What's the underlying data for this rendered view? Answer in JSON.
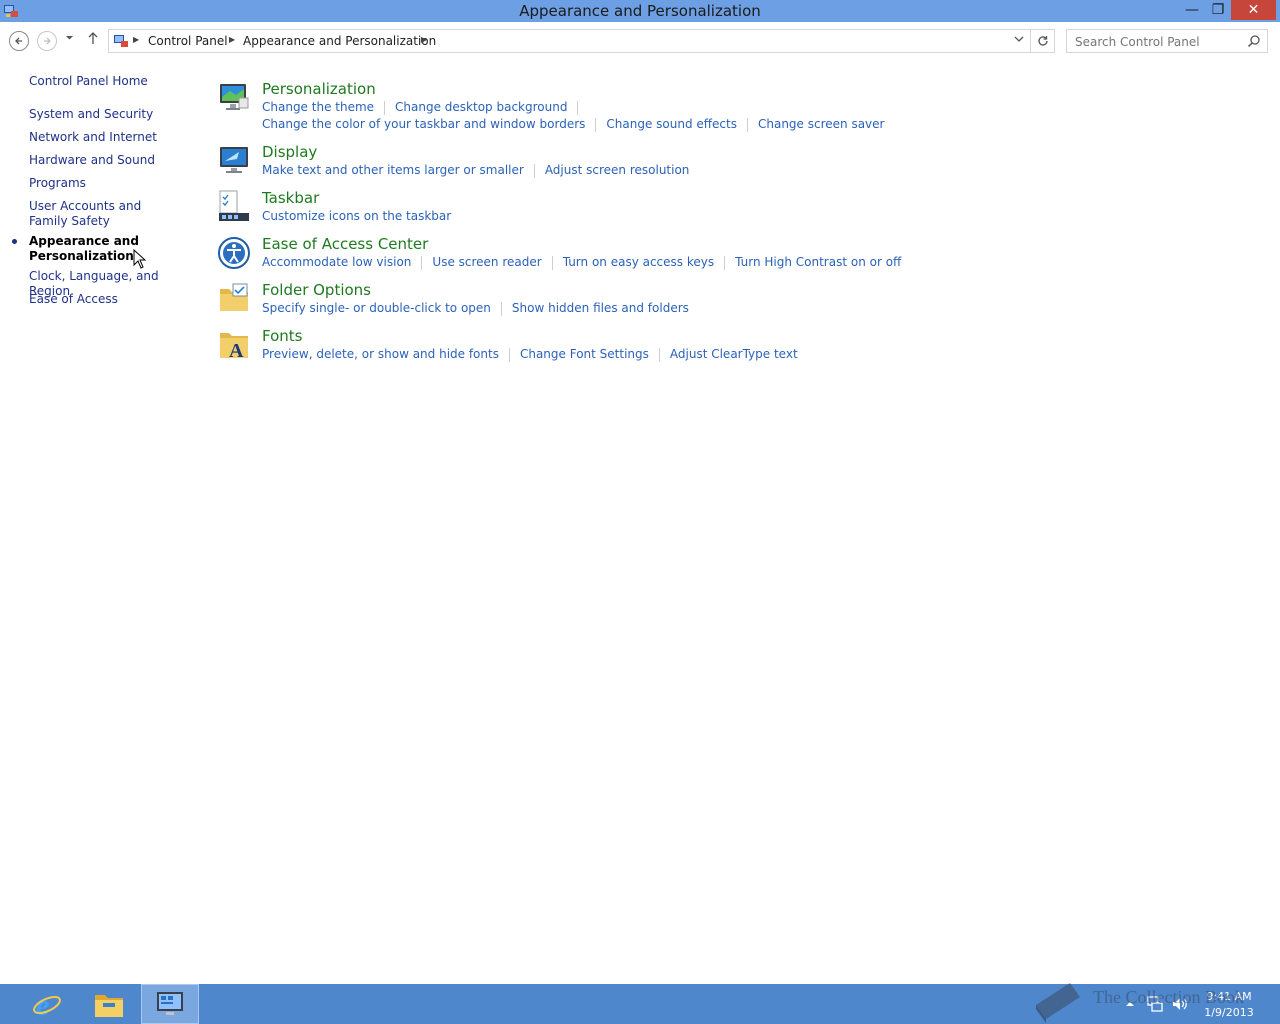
{
  "window": {
    "title": "Appearance and Personalization",
    "minimize_glyph": "—",
    "restore_glyph": "❐",
    "close_glyph": "✕"
  },
  "address_bar": {
    "breadcrumbs": [
      "Control Panel",
      "Appearance and Personalization"
    ],
    "search_placeholder": "Search Control Panel"
  },
  "sidebar": {
    "home": "Control Panel Home",
    "items": [
      {
        "label": "System and Security"
      },
      {
        "label": "Network and Internet"
      },
      {
        "label": "Hardware and Sound"
      },
      {
        "label": "Programs"
      },
      {
        "label": "User Accounts and Family Safety"
      },
      {
        "label": "Appearance and Personalization",
        "current": true
      },
      {
        "label": "Clock, Language, and Region"
      },
      {
        "label": "Ease of Access"
      }
    ]
  },
  "categories": [
    {
      "title": "Personalization",
      "icon": "personalization-icon",
      "links": [
        "Change the theme",
        "Change desktop background",
        "Change the color of your taskbar and window borders",
        "Change sound effects",
        "Change screen saver"
      ]
    },
    {
      "title": "Display",
      "icon": "display-icon",
      "links": [
        "Make text and other items larger or smaller",
        "Adjust screen resolution"
      ]
    },
    {
      "title": "Taskbar",
      "icon": "taskbar-icon",
      "links": [
        "Customize icons on the taskbar"
      ]
    },
    {
      "title": "Ease of Access Center",
      "icon": "ease-of-access-icon",
      "links": [
        "Accommodate low vision",
        "Use screen reader",
        "Turn on easy access keys",
        "Turn High Contrast on or off"
      ]
    },
    {
      "title": "Folder Options",
      "icon": "folder-options-icon",
      "links": [
        "Specify single- or double-click to open",
        "Show hidden files and folders"
      ]
    },
    {
      "title": "Fonts",
      "icon": "fonts-icon",
      "links": [
        "Preview, delete, or show and hide fonts",
        "Change Font Settings",
        "Adjust ClearType text"
      ]
    }
  ],
  "taskbar": {
    "apps": [
      "internet-explorer-icon",
      "file-explorer-icon",
      "control-panel-icon"
    ],
    "active_app": "control-panel-icon",
    "clock_time": "9:41 AM",
    "clock_date": "1/9/2013"
  },
  "watermark": "The Collection Book",
  "colors": {
    "titlebar": "#6d9fe4",
    "taskbar": "#4e87cc",
    "category_title": "#1f7a1f",
    "link": "#2b62b8",
    "sidebar_link": "#1e3287"
  }
}
